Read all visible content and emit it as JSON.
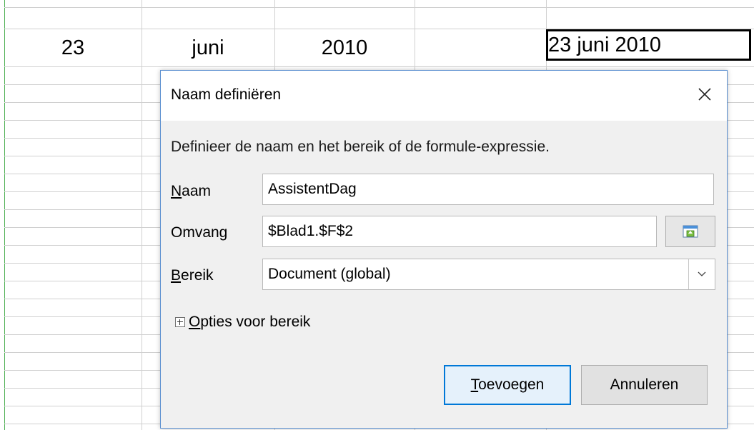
{
  "sheet": {
    "cells": {
      "day": "23",
      "month": "juni",
      "year": "2010",
      "selected_date": "23 juni 2010"
    }
  },
  "dialog": {
    "title": "Naam definiëren",
    "close_icon": "close-icon",
    "description": "Definieer de naam en het bereik of de formule-expressie.",
    "name_label": "Naam",
    "name_value": "AssistentDag",
    "range_label": "Omvang",
    "range_value": "$Blad1.$F$2",
    "shrink_icon": "shrink-icon",
    "scope_label": "Bereik",
    "scope_value": "Document (global)",
    "options_label": "Opties voor bereik",
    "add_button": "Toevoegen",
    "cancel_button": "Annuleren"
  },
  "colors": {
    "accent": "#0078d7",
    "grid": "#d0d0d0",
    "sheet_border": "#4caf50"
  }
}
